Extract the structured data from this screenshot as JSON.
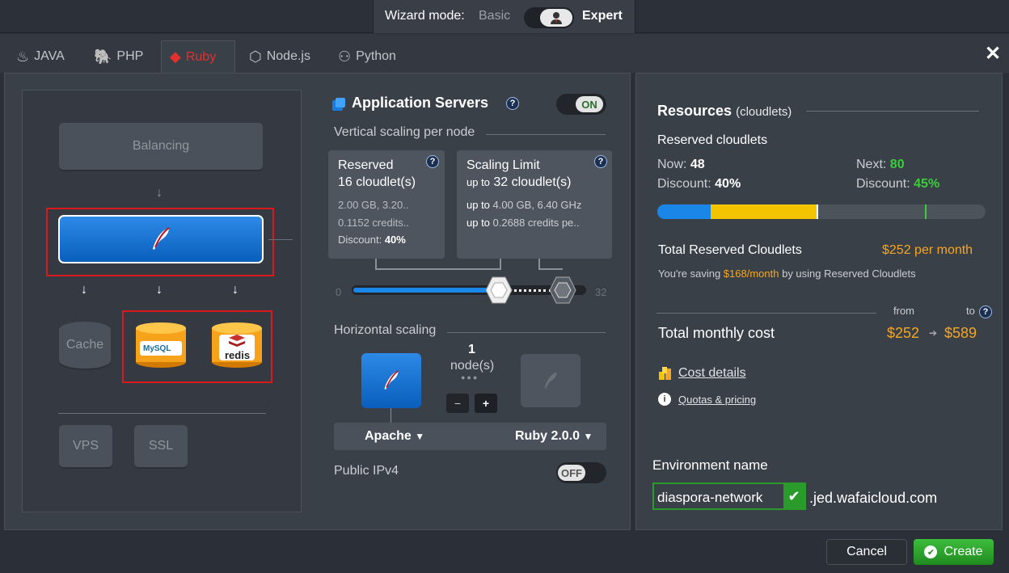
{
  "wizard": {
    "label": "Wizard mode:",
    "basic": "Basic",
    "expert": "Expert"
  },
  "tabs": [
    {
      "label": "JAVA",
      "icon": "java-icon"
    },
    {
      "label": "PHP",
      "icon": "php-icon"
    },
    {
      "label": "Ruby",
      "icon": "ruby-icon"
    },
    {
      "label": "Node.js",
      "icon": "nodejs-icon"
    },
    {
      "label": "Python",
      "icon": "python-icon"
    }
  ],
  "topology": {
    "balancing": "Balancing",
    "cache": "Cache",
    "mysql": "MySQL",
    "redis": "redis",
    "vps": "VPS",
    "ssl": "SSL"
  },
  "app_servers": {
    "title": "Application Servers",
    "toggle": "ON",
    "vertical_label": "Vertical scaling per node",
    "reserved": {
      "title": "Reserved",
      "cloudlets": "16 cloudlet(s)",
      "line1": "2.00 GB, 3.20..",
      "line2": "0.1152 credits..",
      "discount_label": "Discount:",
      "discount": "40%"
    },
    "limit": {
      "title": "Scaling Limit",
      "prefix": "up to",
      "cloudlets": "32 cloudlet(s)",
      "line1_prefix": "up to",
      "line1": "4.00 GB, 6.40 GHz",
      "line2_prefix": "up to",
      "line2": "0.2688 credits pe.."
    },
    "slider_min": "0",
    "slider_max": "32",
    "horizontal_label": "Horizontal scaling",
    "nodes_count": "1",
    "nodes_label": "node(s)",
    "minus": "−",
    "plus": "+",
    "server": "Apache",
    "version": "Ruby 2.0.0",
    "ipv4_label": "Public IPv4",
    "ipv4_toggle": "OFF"
  },
  "resources": {
    "title": "Resources",
    "unit": "(cloudlets)",
    "reserved_label": "Reserved cloudlets",
    "now_label": "Now:",
    "now": "48",
    "next_label": "Next:",
    "next": "80",
    "discount_label": "Discount:",
    "now_discount": "40%",
    "next_discount": "45%",
    "total_reserved_label": "Total Reserved Cloudlets",
    "total_reserved": "$252 per month",
    "saving_pre": "You're saving",
    "saving": "$168/month",
    "saving_post": "by using Reserved Cloudlets",
    "from": "from",
    "to": "to",
    "monthly_label": "Total monthly cost",
    "cost_from": "$252",
    "cost_to": "$589",
    "cost_details": "Cost details",
    "quotas": "Quotas & pricing",
    "env_label": "Environment name",
    "env_name": "diaspora-network",
    "env_domain": ".jed.wafaicloud.com"
  },
  "buttons": {
    "cancel": "Cancel",
    "create": "Create"
  }
}
